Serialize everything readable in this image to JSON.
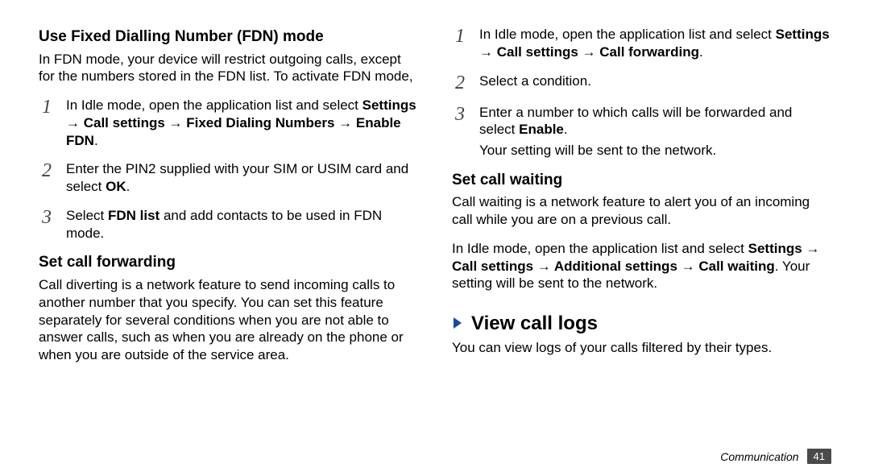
{
  "left": {
    "fdn": {
      "heading": "Use Fixed Dialling Number (FDN) mode",
      "intro": "In FDN mode, your device will restrict outgoing calls, except for the numbers stored in the FDN list. To activate FDN mode,",
      "steps": {
        "n1": "1",
        "s1_a": "In Idle mode, open the application list and select ",
        "s1_b": "Settings → Call settings → Fixed Dialing Numbers → Enable FDN",
        "s1_c": ".",
        "n2": "2",
        "s2_a": "Enter the PIN2 supplied with your SIM or USIM card and select ",
        "s2_b": "OK",
        "s2_c": ".",
        "n3": "3",
        "s3_a": "Select ",
        "s3_b": "FDN list",
        "s3_c": " and add contacts to be used in FDN mode."
      }
    },
    "fwd": {
      "heading": "Set call forwarding",
      "body": "Call diverting is a network feature to send incoming calls to another number that you specify. You can set this feature separately for several conditions when you are not able to answer calls, such as when you are already on the phone or when you are outside of the service area."
    }
  },
  "right": {
    "fwd_steps": {
      "n1": "1",
      "s1_a": "In Idle mode, open the application list and select ",
      "s1_b": "Settings → Call settings → Call forwarding",
      "s1_c": ".",
      "n2": "2",
      "s2": "Select a condition.",
      "n3": "3",
      "s3_a": "Enter a number to which calls will be forwarded and select ",
      "s3_b": "Enable",
      "s3_c": ".",
      "tail": "Your setting will be sent to the network."
    },
    "waiting": {
      "heading": "Set call waiting",
      "body": "Call waiting is a network feature to alert you of an incoming call while you are on a previous call.",
      "p2_a": "In Idle mode, open the application list and select ",
      "p2_b": "Settings → Call settings → Additional settings → Call waiting",
      "p2_c": ". Your setting will be sent to the network."
    },
    "logs": {
      "heading": "View call logs",
      "body": "You can view logs of your calls filtered by their types."
    }
  },
  "footer": {
    "section": "Communication",
    "page": "41"
  }
}
